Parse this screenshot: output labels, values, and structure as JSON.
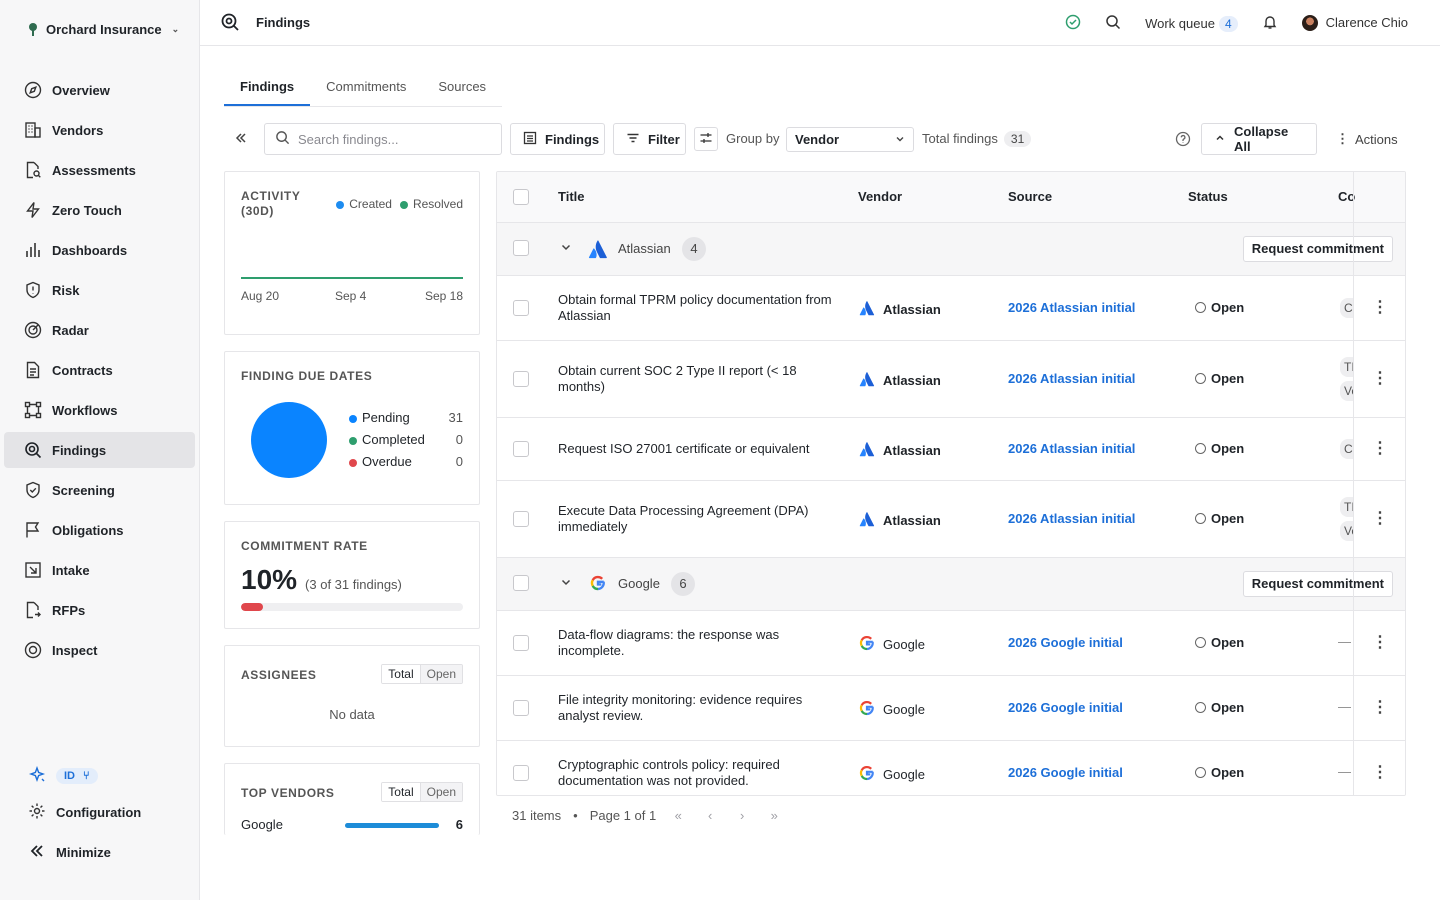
{
  "org": {
    "name": "Orchard Insurance"
  },
  "sidebar": {
    "items": [
      {
        "label": "Overview"
      },
      {
        "label": "Vendors"
      },
      {
        "label": "Assessments"
      },
      {
        "label": "Zero Touch"
      },
      {
        "label": "Dashboards"
      },
      {
        "label": "Risk"
      },
      {
        "label": "Radar"
      },
      {
        "label": "Contracts"
      },
      {
        "label": "Workflows"
      },
      {
        "label": "Findings"
      },
      {
        "label": "Screening"
      },
      {
        "label": "Obligations"
      },
      {
        "label": "Intake"
      },
      {
        "label": "RFPs"
      },
      {
        "label": "Inspect"
      }
    ],
    "active": "Findings",
    "id_badge": "ID",
    "configuration": "Configuration",
    "minimize": "Minimize"
  },
  "topbar": {
    "title": "Findings",
    "work_queue_label": "Work queue",
    "work_queue_count": "4",
    "user_name": "Clarence Chio"
  },
  "tabs": [
    {
      "label": "Findings",
      "active": true
    },
    {
      "label": "Commitments",
      "active": false
    },
    {
      "label": "Sources",
      "active": false
    }
  ],
  "toolbar": {
    "search_placeholder": "Search findings...",
    "findings_btn": "Findings",
    "filter_btn": "Filter",
    "group_by_label": "Group by",
    "group_by_value": "Vendor",
    "total_label": "Total findings",
    "total_count": "31",
    "collapse_btn": "Collapse All",
    "actions_btn": "Actions"
  },
  "activity": {
    "title_line1": "ACTIVITY",
    "title_line2": "(30D)",
    "legend_created": "Created",
    "legend_resolved": "Resolved",
    "x_ticks": [
      "Aug 20",
      "Sep 4",
      "Sep 18"
    ],
    "colors": {
      "created": "#1d8cf0",
      "resolved": "#2e9e6e"
    }
  },
  "due_dates": {
    "title": "FINDING DUE DATES",
    "items": [
      {
        "label": "Pending",
        "value": "31",
        "color": "#0a84ff"
      },
      {
        "label": "Completed",
        "value": "0",
        "color": "#2e9e6e"
      },
      {
        "label": "Overdue",
        "value": "0",
        "color": "#e0474c"
      }
    ]
  },
  "commitment_rate": {
    "title": "COMMITMENT RATE",
    "percent": "10%",
    "detail": "(3 of 31 findings)",
    "fraction": 0.1,
    "bar_color": "#e0474c"
  },
  "assignees": {
    "title": "ASSIGNEES",
    "seg_total": "Total",
    "seg_open": "Open",
    "empty": "No data"
  },
  "top_vendors": {
    "title": "TOP VENDORS",
    "seg_total": "Total",
    "seg_open": "Open",
    "rows": [
      {
        "name": "Google",
        "value": "6",
        "fraction": 1.0
      }
    ]
  },
  "table": {
    "headers": {
      "title": "Title",
      "vendor": "Vendor",
      "source": "Source",
      "status": "Status",
      "co": "Co"
    },
    "request_btn": "Request commitment",
    "groups": [
      {
        "vendor": "Atlassian",
        "count": "4",
        "rows": [
          {
            "title": "Obtain formal TPRM policy documentation from Atlassian",
            "vendor": "Atlassian",
            "source": "2026 Atlassian initial",
            "status": "Open",
            "co": [
              "C"
            ]
          },
          {
            "title": "Obtain current SOC 2 Type II report (< 18 months)",
            "vendor": "Atlassian",
            "source": "2026 Atlassian initial",
            "status": "Open",
            "co": [
              "TI",
              "Ve"
            ]
          },
          {
            "title": "Request ISO 27001 certificate or equivalent",
            "vendor": "Atlassian",
            "source": "2026 Atlassian initial",
            "status": "Open",
            "co": [
              "C"
            ]
          },
          {
            "title": "Execute Data Processing Agreement (DPA) immediately",
            "vendor": "Atlassian",
            "source": "2026 Atlassian initial",
            "status": "Open",
            "co": [
              "TI",
              "Ve"
            ]
          }
        ]
      },
      {
        "vendor": "Google",
        "count": "6",
        "rows": [
          {
            "title": "Data-flow diagrams: the response was incomplete.",
            "vendor": "Google",
            "source": "2026 Google initial",
            "status": "Open",
            "co": [
              "—"
            ]
          },
          {
            "title": "File integrity monitoring: evidence requires analyst review.",
            "vendor": "Google",
            "source": "2026 Google initial",
            "status": "Open",
            "co": [
              "—"
            ]
          },
          {
            "title": "Cryptographic controls policy: required documentation was not provided.",
            "vendor": "Google",
            "source": "2026 Google initial",
            "status": "Open",
            "co": [
              "—"
            ]
          }
        ]
      }
    ]
  },
  "pager": {
    "items": "31 items",
    "page": "Page 1 of 1"
  }
}
